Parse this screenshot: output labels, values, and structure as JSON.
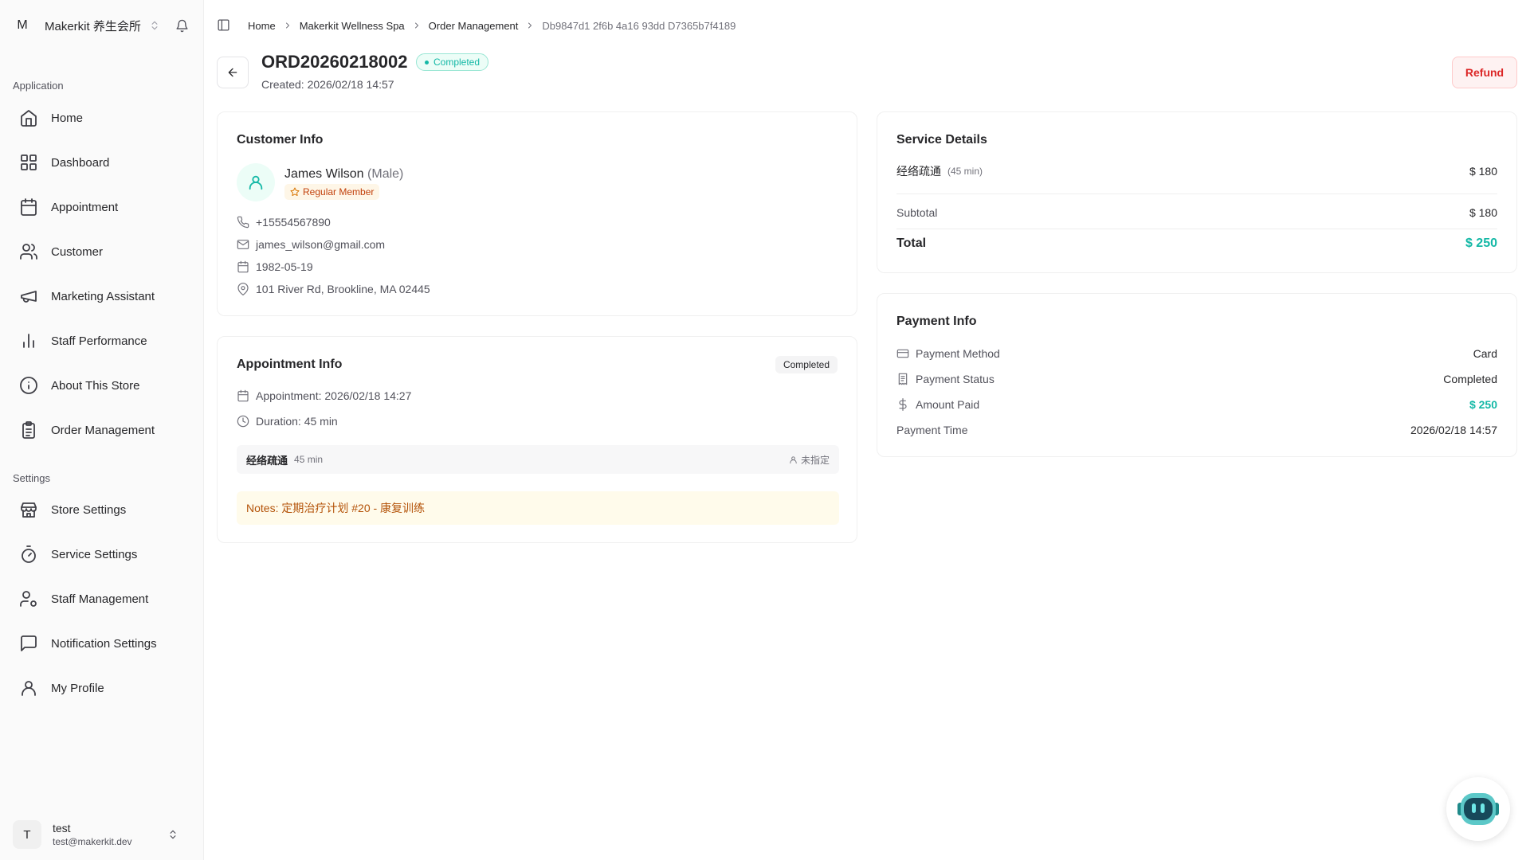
{
  "workspace": {
    "avatar": "M",
    "name": "Makerkit 养生会所"
  },
  "sidebar": {
    "application_label": "Application",
    "application_items": [
      {
        "label": "Home",
        "icon": "home-icon"
      },
      {
        "label": "Dashboard",
        "icon": "grid-icon"
      },
      {
        "label": "Appointment",
        "icon": "calendar-icon"
      },
      {
        "label": "Customer",
        "icon": "users-icon"
      },
      {
        "label": "Marketing Assistant",
        "icon": "megaphone-icon"
      },
      {
        "label": "Staff Performance",
        "icon": "bar-chart-icon"
      },
      {
        "label": "About This Store",
        "icon": "info-icon"
      },
      {
        "label": "Order Management",
        "icon": "clipboard-icon"
      }
    ],
    "settings_label": "Settings",
    "settings_items": [
      {
        "label": "Store Settings",
        "icon": "store-icon"
      },
      {
        "label": "Service Settings",
        "icon": "timer-icon"
      },
      {
        "label": "Staff Management",
        "icon": "user-cog-icon"
      },
      {
        "label": "Notification Settings",
        "icon": "message-icon"
      },
      {
        "label": "My Profile",
        "icon": "user-icon"
      }
    ]
  },
  "user": {
    "avatar": "T",
    "name": "test",
    "email": "test@makerkit.dev"
  },
  "breadcrumb": [
    "Home",
    "Makerkit Wellness Spa",
    "Order Management",
    "Db9847d1 2f6b 4a16 93dd D7365b7f4189"
  ],
  "order": {
    "id": "ORD20260218002",
    "status": "Completed",
    "created": "Created: 2026/02/18 14:57",
    "refund_label": "Refund"
  },
  "customer": {
    "title": "Customer Info",
    "name": "James Wilson",
    "gender": "(Male)",
    "member": "Regular Member",
    "phone": "+15554567890",
    "email": "james_wilson@gmail.com",
    "birthday": "1982-05-19",
    "address": "101 River Rd, Brookline, MA 02445"
  },
  "appointment": {
    "title": "Appointment Info",
    "status": "Completed",
    "time": "Appointment: 2026/02/18 14:27",
    "duration": "Duration: 45 min",
    "service_name": "经络疏通",
    "service_duration": "45 min",
    "staff": "未指定",
    "notes": "Notes: 定期治疗计划 #20 - 康复训练"
  },
  "service_details": {
    "title": "Service Details",
    "item_name": "经络疏通",
    "item_duration": "(45 min)",
    "item_price": "$ 180",
    "subtotal_label": "Subtotal",
    "subtotal_value": "$ 180",
    "total_label": "Total",
    "total_value": "$ 250"
  },
  "payment": {
    "title": "Payment Info",
    "method_label": "Payment Method",
    "method_value": "Card",
    "status_label": "Payment Status",
    "status_value": "Completed",
    "paid_label": "Amount Paid",
    "paid_value": "$ 250",
    "time_label": "Payment Time",
    "time_value": "2026/02/18 14:57"
  },
  "colors": {
    "accent": "#14b8a6",
    "danger": "#dc2626",
    "notes": "#b45309"
  }
}
